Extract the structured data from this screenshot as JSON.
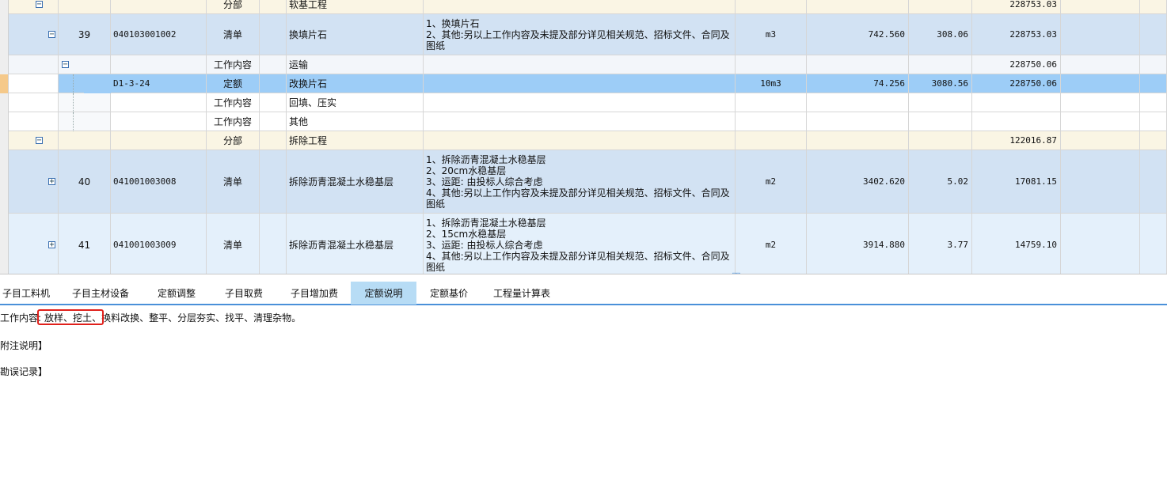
{
  "grid": {
    "rows": [
      {
        "kind": "fenbu",
        "expander": "−",
        "code": "",
        "type": "分部",
        "name": "软基工程",
        "desc": "",
        "unit": "",
        "qty": "",
        "price": "",
        "total": "228753.03"
      },
      {
        "kind": "qingdan",
        "expander": "−",
        "no": "39",
        "code": "040103001002",
        "type": "清单",
        "name": "换填片石",
        "desc": "1、换填片石\n2、其他:另以上工作内容及未提及部分详见相关规范、招标文件、合同及\n图纸",
        "unit": "m3",
        "qty": "742.560",
        "price": "308.06",
        "total": "228753.03"
      },
      {
        "kind": "work",
        "expander": "−",
        "code": "",
        "type": "工作内容",
        "name": "运输",
        "desc": "",
        "unit": "",
        "qty": "",
        "price": "",
        "total": "228750.06"
      },
      {
        "kind": "dinge",
        "expander": "",
        "code": "D1-3-24",
        "type": "定额",
        "name": "改换片石",
        "desc": "",
        "unit": "10m3",
        "qty": "74.256",
        "price": "3080.56",
        "total": "228750.06"
      },
      {
        "kind": "work2",
        "expander": "",
        "code": "",
        "type": "工作内容",
        "name": "回填、压实",
        "desc": "",
        "unit": "",
        "qty": "",
        "price": "",
        "total": ""
      },
      {
        "kind": "work2",
        "expander": "",
        "code": "",
        "type": "工作内容",
        "name": "其他",
        "desc": "",
        "unit": "",
        "qty": "",
        "price": "",
        "total": ""
      },
      {
        "kind": "fenbu",
        "expander": "−",
        "code": "",
        "type": "分部",
        "name": "拆除工程",
        "desc": "",
        "unit": "",
        "qty": "",
        "price": "",
        "total": "122016.87"
      },
      {
        "kind": "qingdan",
        "expander": "+",
        "no": "40",
        "code": "041001003008",
        "type": "清单",
        "name": "拆除沥青混凝土水稳基层",
        "desc": "1、拆除沥青混凝土水稳基层\n2、20cm水稳基层\n3、运距: 由投标人综合考虑\n4、其他:另以上工作内容及未提及部分详见相关规范、招标文件、合同及\n图纸",
        "unit": "m2",
        "qty": "3402.620",
        "price": "5.02",
        "total": "17081.15"
      },
      {
        "kind": "qingdan2",
        "expander": "+",
        "no": "41",
        "code": "041001003009",
        "type": "清单",
        "name": "拆除沥青混凝土水稳基层",
        "desc": "1、拆除沥青混凝土水稳基层\n2、15cm水稳基层\n3、运距: 由投标人综合考虑\n4、其他:另以上工作内容及未提及部分详见相关规范、招标文件、合同及\n图纸",
        "unit": "m2",
        "qty": "3914.880",
        "price": "3.77",
        "total": "14759.10"
      }
    ]
  },
  "tabs": [
    "子目工料机",
    "子目主材设备",
    "定额调整",
    "子目取费",
    "子目增加费",
    "定额说明",
    "定额基价",
    "工程量计算表"
  ],
  "active_tab": "定额说明",
  "content": {
    "work_label": "工作内容:",
    "work_highlight": "放样、挖土、",
    "work_rest": "换料改换、整平、分层夯实、找平、清理杂物。",
    "note_label": "附注说明】",
    "error_label": "勘误记录】"
  },
  "colors": {
    "fenbu_bg": "#faf5e4",
    "qingdan_bg": "#d2e2f3",
    "qingdan2_bg": "#e4f0fb",
    "work_bg": "#f3f6fa",
    "selected_bg": "#9dcdf7",
    "marker": "#f5c98a",
    "highlight_border": "#e0201b"
  }
}
